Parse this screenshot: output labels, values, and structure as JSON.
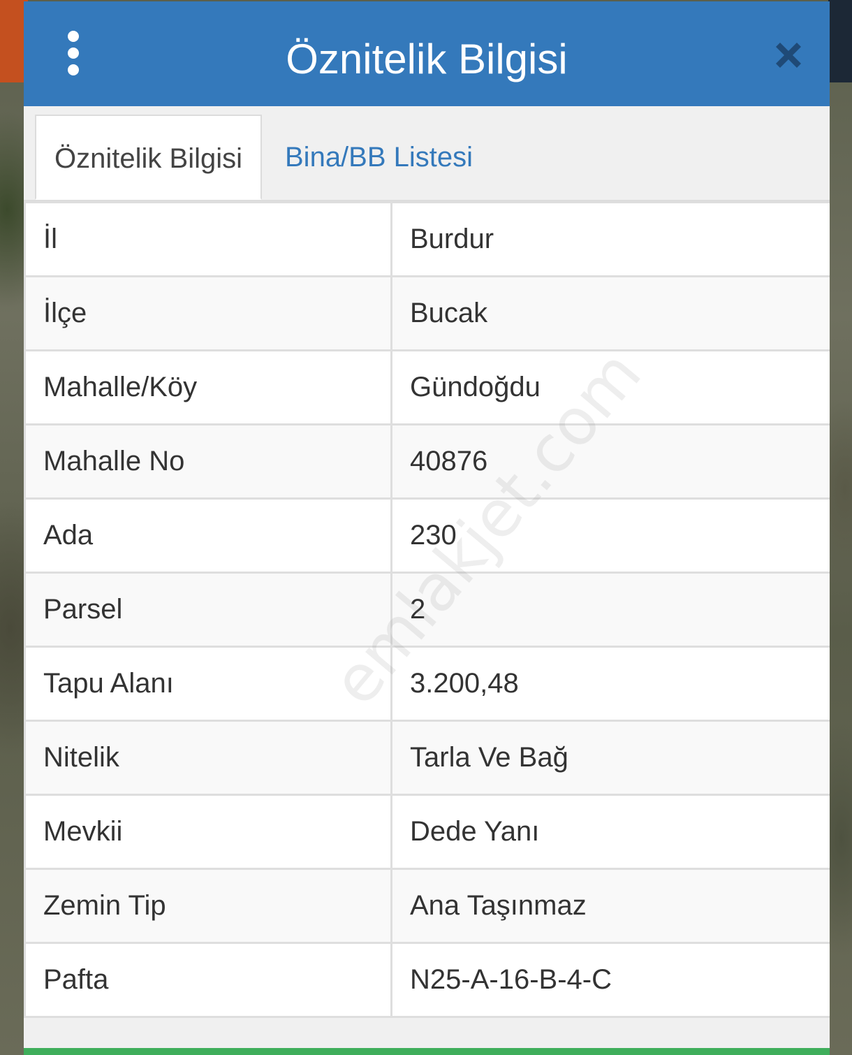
{
  "dialog": {
    "title": "Öznitelik Bilgisi",
    "menu_icon": "vertical-ellipsis-icon",
    "close_icon": "close-x-icon"
  },
  "tabs": [
    {
      "label": "Öznitelik Bilgisi",
      "active": true
    },
    {
      "label": "Bina/BB Listesi",
      "active": false
    }
  ],
  "attributes": [
    {
      "key": "İl",
      "value": "Burdur"
    },
    {
      "key": "İlçe",
      "value": "Bucak"
    },
    {
      "key": "Mahalle/Köy",
      "value": "Gündoğdu"
    },
    {
      "key": "Mahalle No",
      "value": "40876"
    },
    {
      "key": "Ada",
      "value": "230"
    },
    {
      "key": "Parsel",
      "value": "2"
    },
    {
      "key": "Tapu Alanı",
      "value": "3.200,48"
    },
    {
      "key": "Nitelik",
      "value": "Tarla Ve Bağ"
    },
    {
      "key": "Mevkii",
      "value": "Dede Yanı"
    },
    {
      "key": "Zemin Tip",
      "value": "Ana Taşınmaz"
    },
    {
      "key": "Pafta",
      "value": "N25-A-16-B-4-C"
    }
  ],
  "watermark": "emlakjet.com",
  "colors": {
    "header": "#3479bb",
    "tab_link": "#3479bb",
    "bottom_bar": "#3fae5b"
  }
}
